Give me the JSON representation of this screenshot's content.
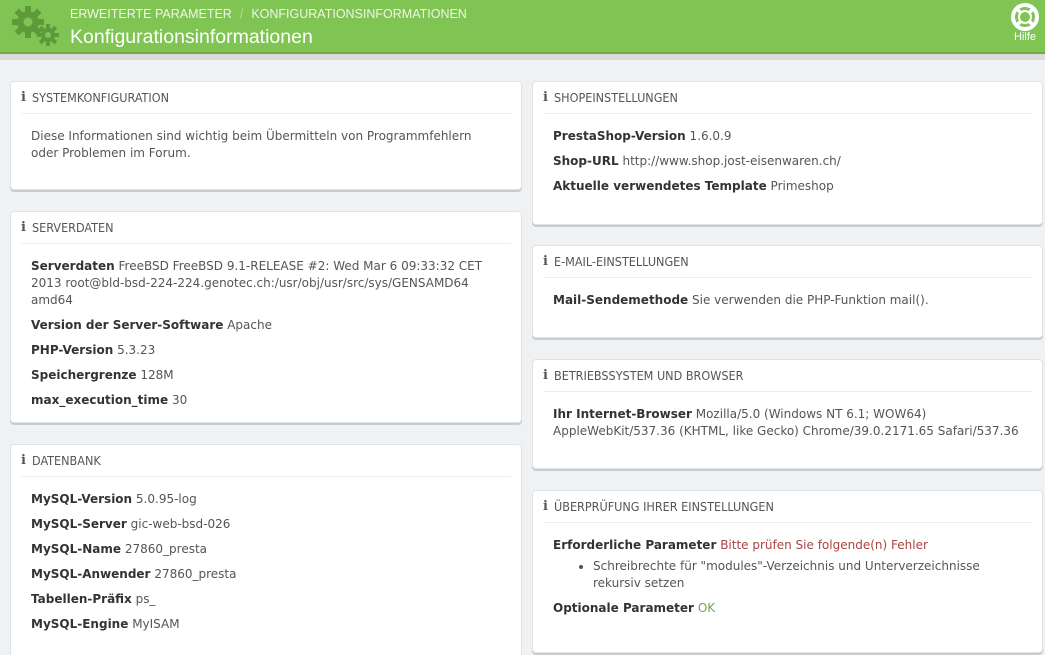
{
  "header": {
    "breadcrumb": [
      "ERWEITERTE PARAMETER",
      "KONFIGURATIONSINFORMATIONEN"
    ],
    "breadcrumb_sep": "/",
    "title": "Konfigurationsinformationen",
    "help_label": "Hilfe",
    "brand_color": "#80c454",
    "logo_icon": "gears-icon",
    "help_icon": "lifebuoy-icon"
  },
  "panels": {
    "system": {
      "title": "SYSTEMKONFIGURATION",
      "text": "Diese Informationen sind wichtig beim Übermitteln von Programmfehlern oder Problemen im Forum."
    },
    "server": {
      "title": "SERVERDATEN",
      "rows": [
        {
          "label": "Serverdaten",
          "value": "FreeBSD FreeBSD 9.1-RELEASE #2: Wed Mar 6 09:33:32 CET 2013 root@bld-bsd-224-224.genotec.ch:/usr/obj/usr/src/sys/GENSAMD64 amd64"
        },
        {
          "label": "Version der Server-Software",
          "value": "Apache"
        },
        {
          "label": "PHP-Version",
          "value": "5.3.23"
        },
        {
          "label": "Speichergrenze",
          "value": "128M"
        },
        {
          "label": "max_execution_time",
          "value": "30"
        }
      ]
    },
    "database": {
      "title": "DATENBANK",
      "rows": [
        {
          "label": "MySQL-Version",
          "value": "5.0.95-log"
        },
        {
          "label": "MySQL-Server",
          "value": "gic-web-bsd-026"
        },
        {
          "label": "MySQL-Name",
          "value": "27860_presta"
        },
        {
          "label": "MySQL-Anwender",
          "value": "27860_presta"
        },
        {
          "label": "Tabellen-Präfix",
          "value": "ps_"
        },
        {
          "label": "MySQL-Engine",
          "value": "MyISAM"
        }
      ]
    },
    "shop": {
      "title": "SHOPEINSTELLUNGEN",
      "rows": [
        {
          "label": "PrestaShop-Version",
          "value": "1.6.0.9"
        },
        {
          "label": "Shop-URL",
          "value": "http://www.shop.jost-eisenwaren.ch/"
        },
        {
          "label": "Aktuelle verwendetes Template",
          "value": "Primeshop"
        }
      ]
    },
    "email": {
      "title": "E-MAIL-EINSTELLUNGEN",
      "rows": [
        {
          "label": "Mail-Sendemethode",
          "value": "Sie verwenden die PHP-Funktion mail()."
        }
      ]
    },
    "os": {
      "title": "BETRIEBSSYSTEM UND BROWSER",
      "rows": [
        {
          "label": "Ihr Internet-Browser",
          "value": "Mozilla/5.0 (Windows NT 6.1; WOW64) AppleWebKit/537.36 (KHTML, like Gecko) Chrome/39.0.2171.65 Safari/537.36"
        }
      ]
    },
    "check": {
      "title": "ÜBERPRÜFUNG IHRER EINSTELLUNGEN",
      "required_label": "Erforderliche Parameter",
      "required_value": "Bitte prüfen Sie folgende(n) Fehler",
      "errors": [
        "Schreibrechte für \"modules\"-Verzeichnis und Unterverzeichnisse rekursiv setzen"
      ],
      "optional_label": "Optionale Parameter",
      "optional_value": "OK"
    }
  }
}
